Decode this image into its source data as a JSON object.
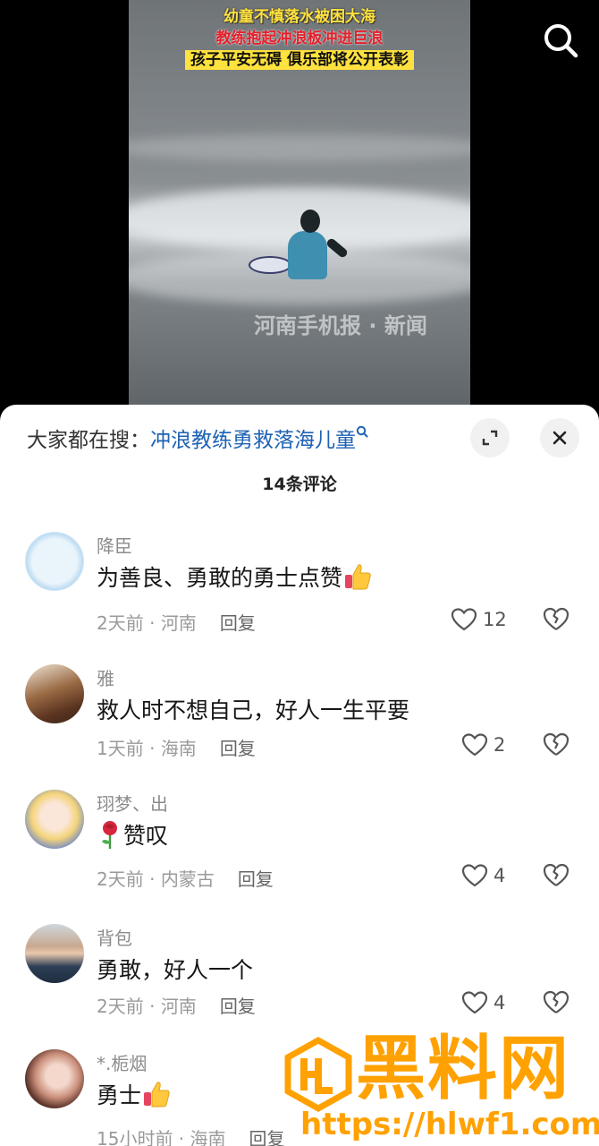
{
  "video": {
    "caption_line1": "幼童不慎落水被困大海",
    "caption_line2": "教练抱起冲浪板冲进巨浪",
    "caption_line3": "孩子平安无碍 俱乐部将公开表彰",
    "watermark": "河南手机报 · 新闻"
  },
  "icons": {
    "search": "search-icon",
    "expand": "expand-icon",
    "close": "close-icon",
    "like": "heart-icon",
    "dislike": "broken-heart-icon"
  },
  "sheet": {
    "search_prefix": "大家都在搜：",
    "search_query": "冲浪教练勇救落海儿童",
    "comment_count": "14条评论"
  },
  "comments": [
    {
      "user": "降臣",
      "text": "为善良、勇敢的勇士点赞",
      "emoji": "thumbs-up",
      "time": "2天前",
      "location": "河南",
      "reply": "回复",
      "likes": "12"
    },
    {
      "user": "雅",
      "text": "救人时不想自己，好人一生平要",
      "emoji": "",
      "time": "1天前",
      "location": "海南",
      "reply": "回复",
      "likes": "2"
    },
    {
      "user": "珝梦、出",
      "text": "赞叹",
      "emoji": "rose",
      "time": "2天前",
      "location": "内蒙古",
      "reply": "回复",
      "likes": "4"
    },
    {
      "user": "背包",
      "text": "勇敢，好人一个",
      "emoji": "",
      "time": "2天前",
      "location": "河南",
      "reply": "回复",
      "likes": "4"
    },
    {
      "user": "*.栀烟",
      "text": "勇士",
      "emoji": "thumbs-up",
      "time": "15小时前",
      "location": "海南",
      "reply": "回复",
      "likes": ""
    }
  ],
  "site_watermark": {
    "name": "黑料网",
    "url": "https://hlwf1.com"
  },
  "colors": {
    "accent_link": "#1e62b4",
    "caption_yellow": "#ffe23d",
    "caption_red": "#e4202b",
    "watermark_orange": "#ffa100"
  }
}
